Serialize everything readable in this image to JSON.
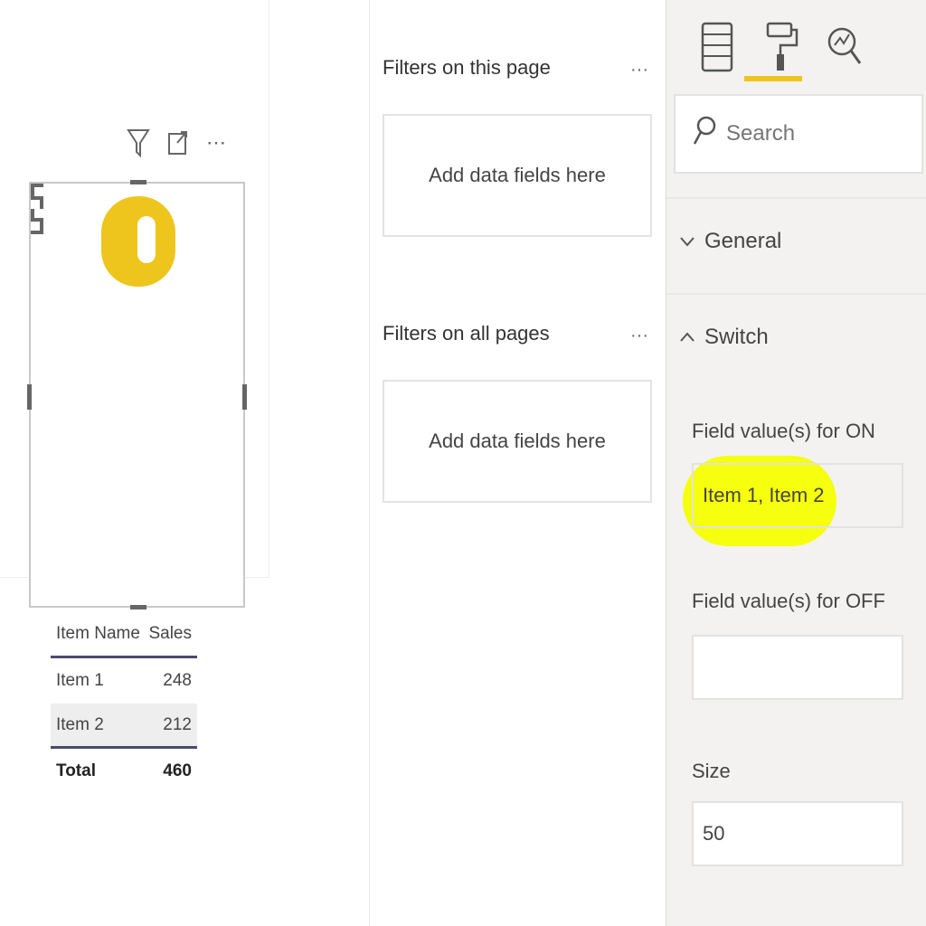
{
  "canvas": {
    "visual_header": {
      "filter_icon": "filter-icon",
      "focus_icon": "focus-mode-icon",
      "more_label": "⋯"
    },
    "toggle": {
      "state": "on",
      "color": "#eec51d"
    },
    "table": {
      "headers": [
        "Item Name",
        "Sales"
      ],
      "rows": [
        {
          "name": "Item 1",
          "sales": "248"
        },
        {
          "name": "Item 2",
          "sales": "212"
        }
      ],
      "total": {
        "label": "Total",
        "value": "460"
      }
    }
  },
  "filters": {
    "page": {
      "title": "Filters on this page",
      "more": "···",
      "placeholder": "Add data fields here"
    },
    "all": {
      "title": "Filters on all pages",
      "more": "···",
      "placeholder": "Add data fields here"
    }
  },
  "format": {
    "tabs": [
      {
        "name": "fields",
        "icon": "fields-icon",
        "active": false
      },
      {
        "name": "format",
        "icon": "paint-roller-icon",
        "active": true
      },
      {
        "name": "analytics",
        "icon": "analytics-icon",
        "active": false
      }
    ],
    "accent": "#eec51d",
    "search": {
      "placeholder": "Search"
    },
    "sections": {
      "general": {
        "label": "General",
        "expanded": false
      },
      "switch": {
        "label": "Switch",
        "expanded": true
      }
    },
    "fields": {
      "on": {
        "label": "Field value(s) for ON",
        "value": "Item 1, Item 2"
      },
      "off": {
        "label": "Field value(s) for OFF",
        "value": ""
      },
      "size": {
        "label": "Size",
        "value": "50"
      }
    }
  }
}
